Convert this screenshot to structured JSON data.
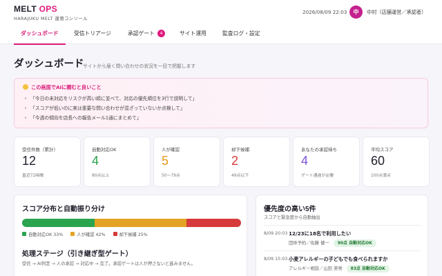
{
  "header": {
    "brand_main": "MELT",
    "brand_accent": "OPS",
    "brand_sub": "HARAJUKU MELT 運用コンソール",
    "clock": "2026/08/09 22:03",
    "avatar_initial": "中",
    "user": "中村（店舗運営／承認者）"
  },
  "tabs": [
    {
      "label": "ダッシュボード"
    },
    {
      "label": "受信トリアージ"
    },
    {
      "label": "承認ゲート",
      "badge": "4"
    },
    {
      "label": "サイト運用"
    },
    {
      "label": "監査ログ・設定"
    }
  ],
  "page": {
    "title": "ダッシュボード",
    "subtitle": "サイトから届く問い合わせの状況を一目で把握します"
  },
  "tips": {
    "heading": "この画面でAIに頼むと良いこと",
    "items": [
      "「今日の未対応をリスクが高い順に並べて、対応の優先順位を3行で説明して」",
      "「スコアが低いのに実は重要な問い合わせが混ざっていないか点検して」",
      "「今週の傾向を店長への報告メール1通にまとめて」"
    ]
  },
  "kpis": [
    {
      "label": "受信件数（累計）",
      "value": "12",
      "note": "直近72時間",
      "color": "#1f1f2b"
    },
    {
      "label": "自動対応OK",
      "value": "4",
      "note": "80点以上",
      "color": "#26a34b"
    },
    {
      "label": "人が確認",
      "value": "5",
      "note": "50〜79点",
      "color": "#e39a14"
    },
    {
      "label": "却下候補",
      "value": "2",
      "note": "49点以下",
      "color": "#d63a3a"
    },
    {
      "label": "あなたの承認待ち",
      "value": "4",
      "note": "ゲート通過が必要",
      "color": "#7a52d6"
    },
    {
      "label": "平均スコア",
      "value": "60",
      "note": "100点満点",
      "color": "#1f1f2b"
    }
  ],
  "score": {
    "title": "スコア分布と自動振り分け",
    "segments": [
      {
        "label": "自動対応OK",
        "percent": 33,
        "color": "#2aa44f"
      },
      {
        "label": "人が確認",
        "percent": 42,
        "color": "#e3a324"
      },
      {
        "label": "却下候補",
        "percent": 25,
        "color": "#d63a3a"
      }
    ],
    "legend": [
      "自動対応OK 33%",
      "人が確認 42%",
      "却下候補 25%"
    ],
    "stage_title": "処理ステージ（引き継ぎ型ゲート）",
    "stage_sub": "受信 → AI判定 → 人の承認 → 対応中 → 完了。承認ゲートは人が押さないと進みません。"
  },
  "priority": {
    "title": "優先度の高い5件",
    "subtitle": "スコアと緊急度から自動抽出",
    "items": [
      {
        "time": "8/09 20:03",
        "name": "12/23に18名で利用したい",
        "meta": "団体予約／佐藤 健一",
        "pill": "90点 自動対応OK"
      },
      {
        "time": "8/09 15:03",
        "name": "小麦アレルギーの子どもでも食べられますか",
        "meta": "アレルギー相談／山田 美咲",
        "pill": "83点 自動対応OK"
      }
    ]
  }
}
